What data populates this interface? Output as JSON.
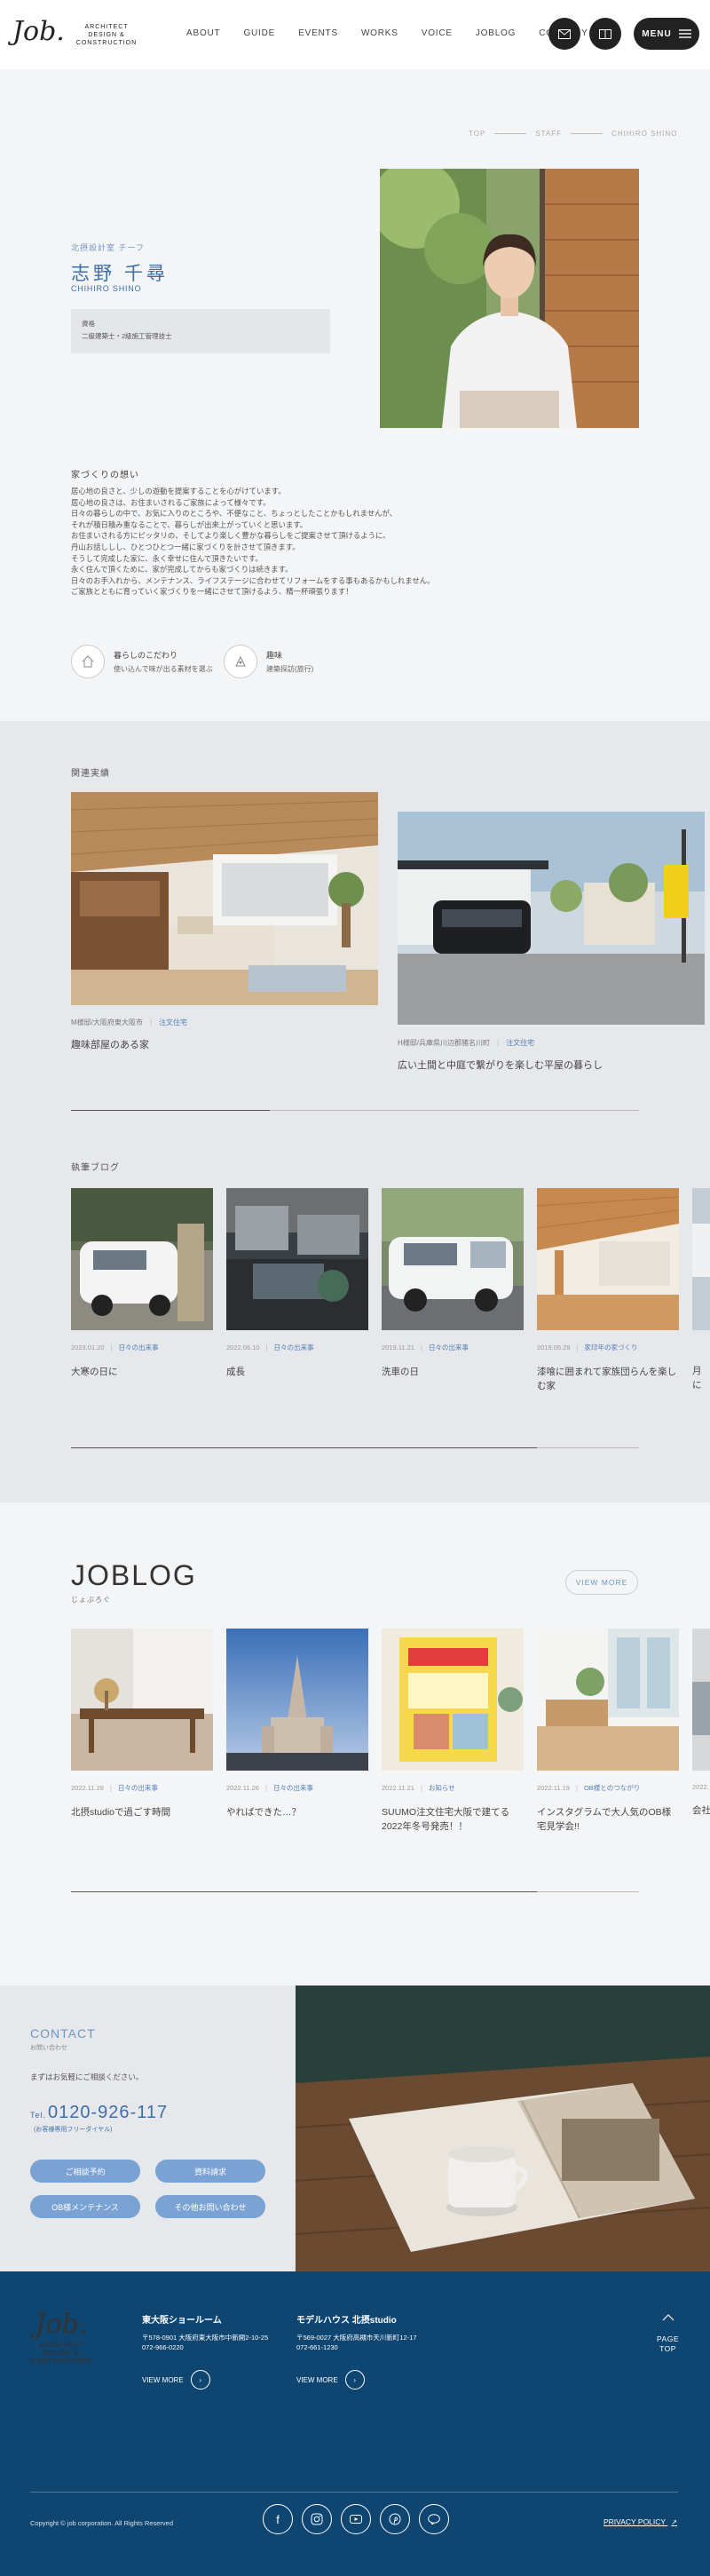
{
  "header": {
    "logo_mark": "Job.",
    "logo_sub": "ARCHITECT DESIGN & CONSTRUCTION",
    "nav": [
      "ABOUT",
      "GUIDE",
      "EVENTS",
      "WORKS",
      "VOICE",
      "JOBLOG",
      "COMPANY"
    ],
    "menu_label": "MENU"
  },
  "breadcrumb": [
    "TOP",
    "STAFF",
    "CHIHIRO SHINO"
  ],
  "profile": {
    "role": "北摂設計室 チーフ",
    "name": "志野 千尋",
    "name_en": "CHIHIRO SHINO",
    "qual_label": "資格",
    "qual_value": "二級建築士・2級施工管理技士"
  },
  "vision": {
    "title": "家づくりの想い",
    "text": "居心地の良さと、少しの遊動を提案することを心がけています。\n居心地の良さは、お住まいされるご家族によって様々です。\n日々の暮らしの中で、お気に入りのところや、不便なこと、ちょっとしたことかもしれませんが、\nそれが積日積み重なることで、暮らしが出来上がっていくと思います。\nお住まいされる方にピッタリの、そしてより楽しく豊かな暮らしをご提案させて頂けるように、\n丹山お話ししし、ひとつひとつ一緒に家づくりを計させて頂きます。\nそうして完成した家に、永く幸せに住んで頂きたいです。\n永く住んで頂くために、家が完成してからも家づくりは続きます。\n日々のお手入れから、メンテナンス、ライフステージに合わせてリフォームをする事もあるかもしれません。\nご家族とともに育っていく家づくりを一緒にさせて頂けるよう、精一杯頑張ります！"
  },
  "features": [
    {
      "title": "暮らしのこだわり",
      "text": "使い込んで味が出る素材を選ぶ"
    },
    {
      "title": "趣味",
      "text": "建築探訪(旅行)"
    }
  ],
  "related": {
    "label": "関連実績",
    "progress": 0.35,
    "cards": [
      {
        "place": "M様邸/大阪府東大阪市",
        "tag": "注文住宅",
        "title": "趣味部屋のある家"
      },
      {
        "place": "H様邸/兵庫県川辺郡猪名川町",
        "tag": "注文住宅",
        "title": "広い土間と中庭で繋がりを楽しむ平屋の暮らし"
      }
    ]
  },
  "staffblog": {
    "label": "執筆ブログ",
    "progress": 0.82,
    "cards": [
      {
        "date": "2023.01.20",
        "tag": "日々の出来事",
        "title": "大寒の日に"
      },
      {
        "date": "2022.06.10",
        "tag": "日々の出来事",
        "title": "成長"
      },
      {
        "date": "2019.11.21",
        "tag": "日々の出来事",
        "title": "洗車の日"
      },
      {
        "date": "2019.05.29",
        "tag": "家印年の家づくり",
        "title": "漆喰に囲まれて家族団らんを楽しむ家"
      },
      {
        "date": "",
        "tag": "",
        "title": "月に"
      }
    ]
  },
  "joblog": {
    "title": "JOBLOG",
    "sub": "じょぶろぐ",
    "viewmore": "VIEW MORE",
    "progress": 0.82,
    "cards": [
      {
        "date": "2022.11.28",
        "tag": "日々の出来事",
        "title": "北摂studioで過ごす時間"
      },
      {
        "date": "2022.11.26",
        "tag": "日々の出来事",
        "title": "やればできた…？"
      },
      {
        "date": "2022.11.21",
        "tag": "お知らせ",
        "title": "SUUMO注文住宅大阪で建てる2022年冬号発売！！"
      },
      {
        "date": "2022.11.19",
        "tag": "OB様とのつながり",
        "title": "インスタグラムで大人気のOB様宅見学会!!"
      },
      {
        "date": "2022.",
        "tag": "",
        "title": "会社"
      }
    ]
  },
  "contact": {
    "title": "CONTACT",
    "sub": "お問い合わせ",
    "text": "まずはお気軽にご相談ください。",
    "tel_prefix": "Tel.",
    "tel": "0120-926-117",
    "tel_note": "(お客様専用フリーダイヤル)",
    "buttons": [
      "ご相談予約",
      "資料請求",
      "OB様メンテナンス",
      "その他お問い合わせ"
    ]
  },
  "footer": {
    "logo_mark": "Job.",
    "logo_sub": "ARCHITECT DESIGN & CONSTRUCTION",
    "showrooms": [
      {
        "name": "東大阪ショールーム",
        "zip": "〒578-0901 大阪府東大阪市中新開2-10-25",
        "tel": "072-966-0220",
        "vm": "VIEW MORE"
      },
      {
        "name": "モデルハウス 北摂studio",
        "zip": "〒569-0027 大阪府高槻市天川新町12-17",
        "tel": "072-661-1230",
        "vm": "VIEW MORE"
      }
    ],
    "pagetop": [
      "PAGE",
      "TOP"
    ],
    "copyright": "Copyright © job corporation. All Rights Reserved",
    "privacy": "PRIVACY POLICY"
  },
  "colors": {
    "accent": "#3c6ea7",
    "footer": "#0f4571",
    "button": "#7aa3d3"
  }
}
